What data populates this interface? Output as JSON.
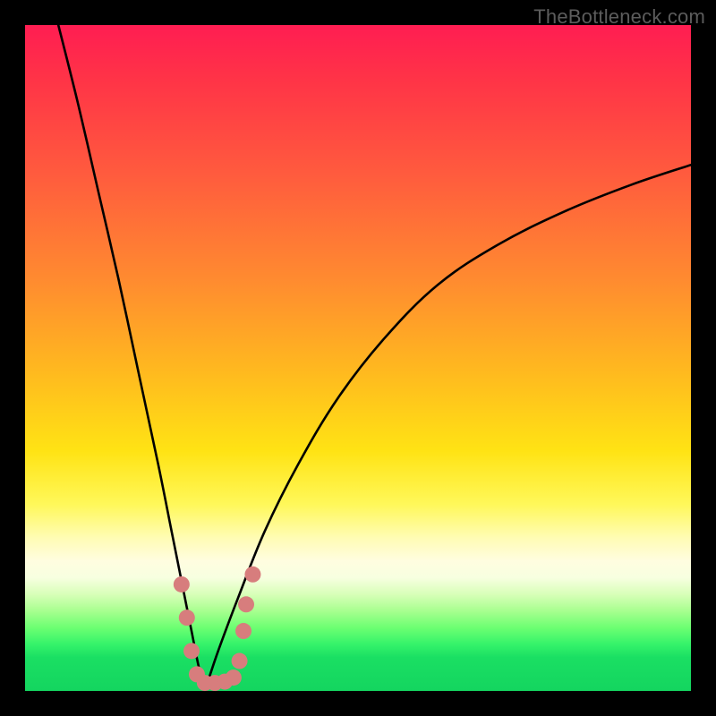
{
  "watermark": "TheBottleneck.com",
  "chart_data": {
    "type": "line",
    "title": "",
    "xlabel": "",
    "ylabel": "",
    "xlim": [
      0,
      100
    ],
    "ylim": [
      0,
      100
    ],
    "grid": false,
    "legend": false,
    "description": "Bottleneck-style V curve. Y≈100 means severe bottleneck (top, red zone), Y≈0 means balanced (bottom, green zone). Minimum around x≈27.",
    "series": [
      {
        "name": "left-branch",
        "x": [
          5,
          8,
          11,
          14,
          17,
          20,
          22,
          24,
          25,
          26,
          27
        ],
        "y": [
          100,
          88,
          75,
          62,
          48,
          34,
          24,
          14,
          9,
          4,
          0
        ]
      },
      {
        "name": "right-branch",
        "x": [
          27,
          29,
          32,
          36,
          41,
          47,
          54,
          62,
          71,
          81,
          91,
          100
        ],
        "y": [
          0,
          6,
          14,
          24,
          34,
          44,
          53,
          61,
          67,
          72,
          76,
          79
        ]
      }
    ],
    "markers": {
      "color": "#d77d7d",
      "points": [
        {
          "x": 23.5,
          "y": 16
        },
        {
          "x": 24.3,
          "y": 11
        },
        {
          "x": 25.0,
          "y": 6
        },
        {
          "x": 25.8,
          "y": 2.5
        },
        {
          "x": 27.0,
          "y": 1.2
        },
        {
          "x": 28.5,
          "y": 1.2
        },
        {
          "x": 30.0,
          "y": 1.4
        },
        {
          "x": 31.3,
          "y": 2.0
        },
        {
          "x": 32.2,
          "y": 4.5
        },
        {
          "x": 32.8,
          "y": 9
        },
        {
          "x": 33.2,
          "y": 13
        },
        {
          "x": 34.2,
          "y": 17.5
        }
      ]
    }
  }
}
